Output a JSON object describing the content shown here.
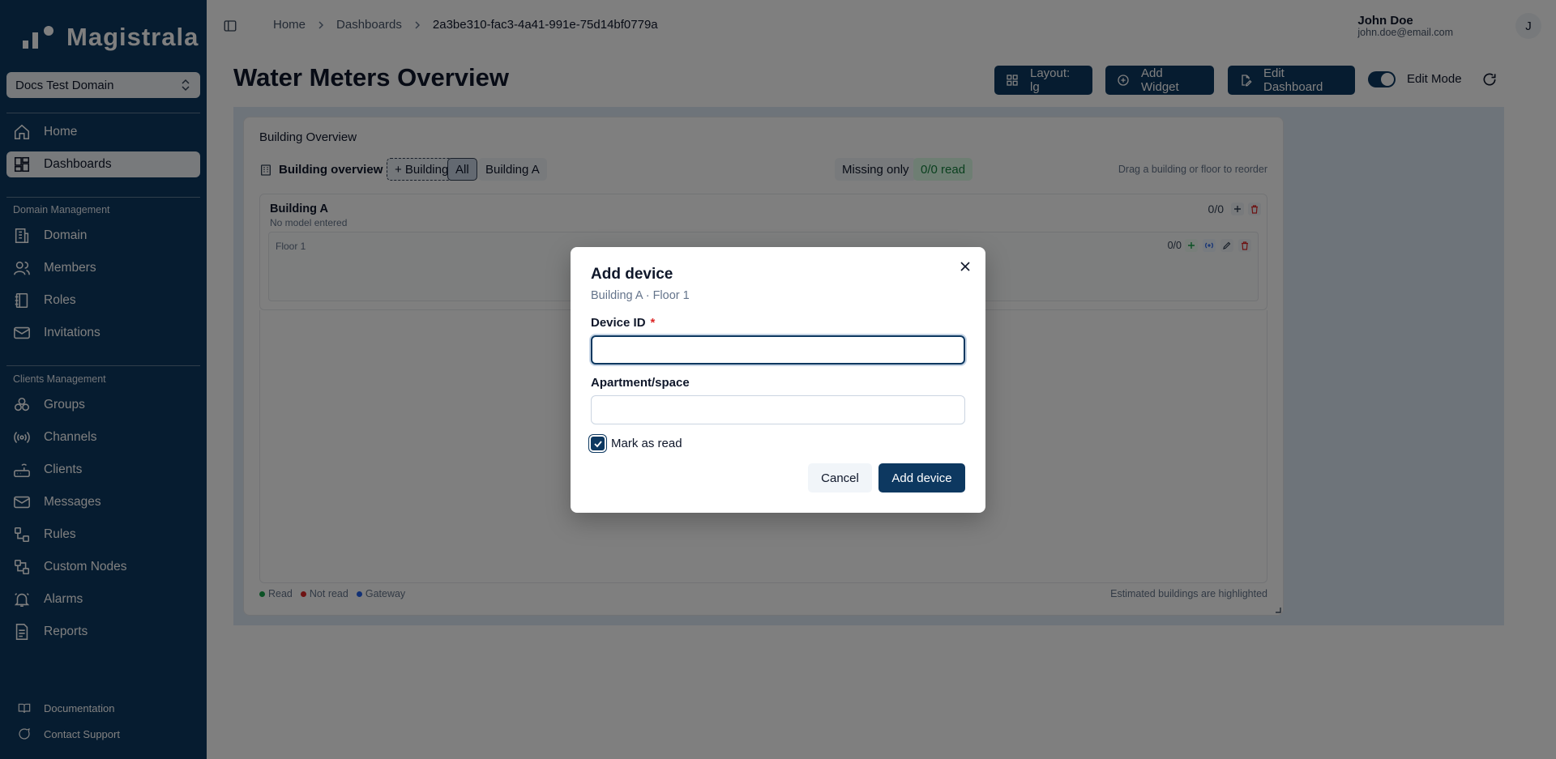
{
  "brand": {
    "name": "Magistrala"
  },
  "sidebar": {
    "domain_select": "Docs Test Domain",
    "primary": [
      {
        "label": "Home",
        "icon": "home-icon"
      },
      {
        "label": "Dashboards",
        "icon": "dashboard-grid-icon",
        "active": true
      }
    ],
    "domain_section": {
      "title": "Domain Management",
      "items": [
        {
          "label": "Domain",
          "icon": "building-icon"
        },
        {
          "label": "Members",
          "icon": "users-icon"
        },
        {
          "label": "Roles",
          "icon": "book-icon"
        },
        {
          "label": "Invitations",
          "icon": "mail-icon"
        }
      ]
    },
    "clients_section": {
      "title": "Clients Management",
      "items": [
        {
          "label": "Groups",
          "icon": "groups-icon"
        },
        {
          "label": "Channels",
          "icon": "radio-icon"
        },
        {
          "label": "Clients",
          "icon": "router-icon"
        },
        {
          "label": "Messages",
          "icon": "messages-icon"
        },
        {
          "label": "Rules",
          "icon": "workflow-icon"
        },
        {
          "label": "Custom Nodes",
          "icon": "nodes-icon"
        },
        {
          "label": "Alarms",
          "icon": "bell-icon"
        },
        {
          "label": "Reports",
          "icon": "report-icon"
        }
      ]
    },
    "footer": [
      {
        "label": "Documentation",
        "icon": "docs-icon"
      },
      {
        "label": "Contact Support",
        "icon": "chat-icon"
      }
    ]
  },
  "topbar": {
    "breadcrumbs": [
      "Home",
      "Dashboards",
      "2a3be310-fac3-4a41-991e-75d14bf0779a"
    ],
    "user": {
      "name": "John Doe",
      "email": "john.doe@email.com",
      "initial": "J"
    }
  },
  "header": {
    "title": "Water Meters Overview",
    "layout_label": "Layout: lg",
    "add_widget_label": "Add Widget",
    "edit_dashboard_label": "Edit Dashboard",
    "edit_mode_label": "Edit Mode",
    "edit_mode_on": true
  },
  "widget": {
    "title": "Building Overview",
    "overview_label": "Building overview",
    "add_building": "+ Building",
    "filter_all": "All",
    "filter_building": "Building A",
    "missing_only": "Missing only",
    "read_count": "0/0 read",
    "drag_hint": "Drag a building or floor to reorder",
    "building": {
      "name": "Building A",
      "model": "No model entered",
      "count": "0/0"
    },
    "floor": {
      "name": "Floor 1",
      "count": "0/0"
    },
    "legend": [
      {
        "label": "Read",
        "color": "#16a34a"
      },
      {
        "label": "Not read",
        "color": "#dc2626"
      },
      {
        "label": "Gateway",
        "color": "#2563eb"
      }
    ],
    "legend_note": "Estimated buildings are highlighted"
  },
  "modal": {
    "title": "Add device",
    "subtitle": "Building A · Floor 1",
    "device_id_label": "Device ID",
    "required_mark": "*",
    "device_id_value": "",
    "apartment_label": "Apartment/space",
    "apartment_value": "",
    "mark_as_read_label": "Mark as read",
    "mark_as_read_checked": true,
    "cancel_label": "Cancel",
    "submit_label": "Add device"
  },
  "colors": {
    "primary": "#0d3860",
    "danger": "#dc2626",
    "success": "#16a34a"
  }
}
